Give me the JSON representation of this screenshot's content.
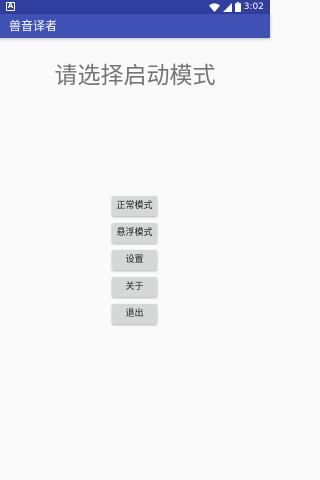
{
  "status_bar": {
    "time": "3:02",
    "notification_icon": "a-square-icon",
    "wifi_icon": "wifi-icon",
    "signal_icon": "signal-icon",
    "battery_icon": "battery-icon",
    "notification_glyph": "A"
  },
  "app_bar": {
    "title": "兽音译者"
  },
  "main": {
    "heading": "请选择启动模式",
    "buttons": [
      {
        "label": "正常模式"
      },
      {
        "label": "悬浮模式"
      },
      {
        "label": "设置"
      },
      {
        "label": "关于"
      },
      {
        "label": "退出"
      }
    ]
  },
  "colors": {
    "status_bar": "#303f9f",
    "app_bar": "#3f51b5",
    "background": "#fafafa",
    "button": "#d6d7d7",
    "heading_text": "#757575"
  }
}
